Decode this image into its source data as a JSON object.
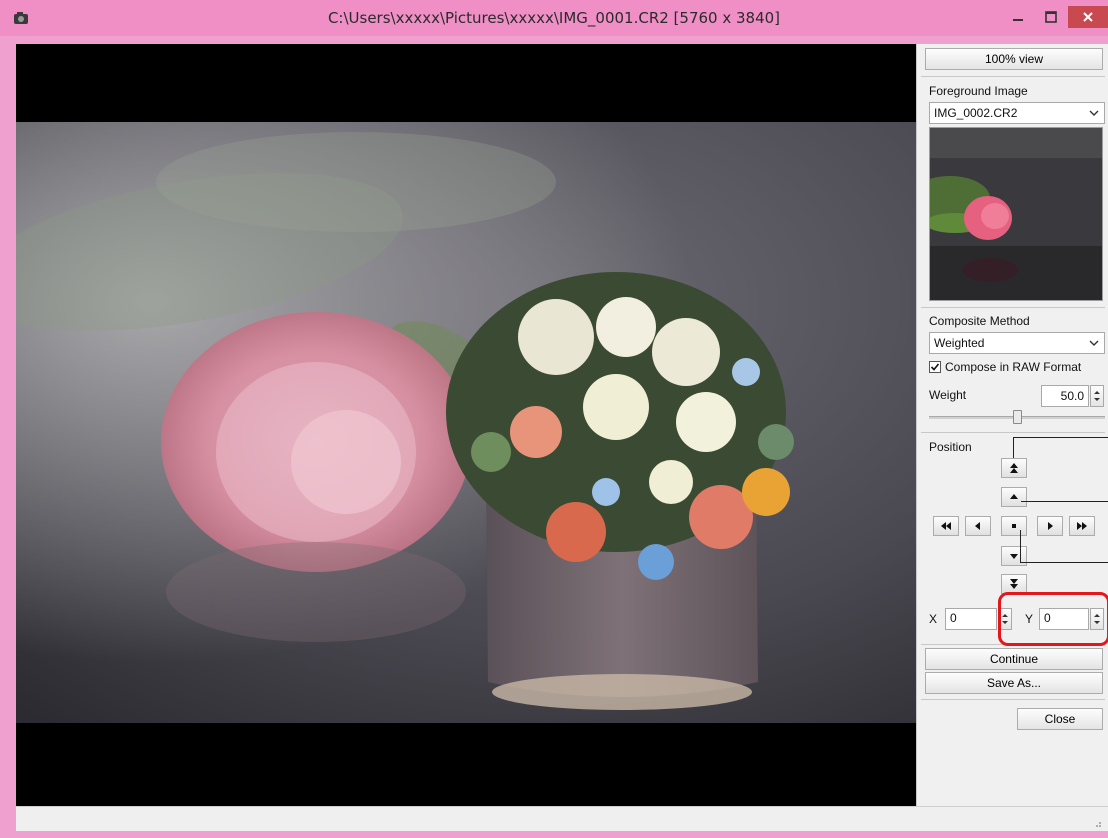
{
  "window": {
    "title": "C:\\Users\\xxxxx\\Pictures\\xxxxx\\IMG_0001.CR2 [5760 x 3840]"
  },
  "panel": {
    "view_100_label": "100% view",
    "foreground_label": "Foreground Image",
    "foreground_value": "IMG_0002.CR2",
    "composite_label": "Composite Method",
    "composite_value": "Weighted",
    "raw_checkbox_label": "Compose in RAW Format",
    "raw_checked": true,
    "weight_label": "Weight",
    "weight_value": "50.0",
    "weight_slider_fraction": 0.5,
    "position_label": "Position",
    "x_label": "X",
    "x_value": "0",
    "y_label": "Y",
    "y_value": "0",
    "continue_label": "Continue",
    "save_as_label": "Save As...",
    "close_label": "Close"
  },
  "icons": {
    "app": "app-icon",
    "minimize": "minimize-icon",
    "maximize": "maximize-icon",
    "close": "close-icon"
  },
  "colors": {
    "titlebar": "#ef8fc6",
    "close_button": "#c84a50",
    "highlight": "#e4161c"
  }
}
